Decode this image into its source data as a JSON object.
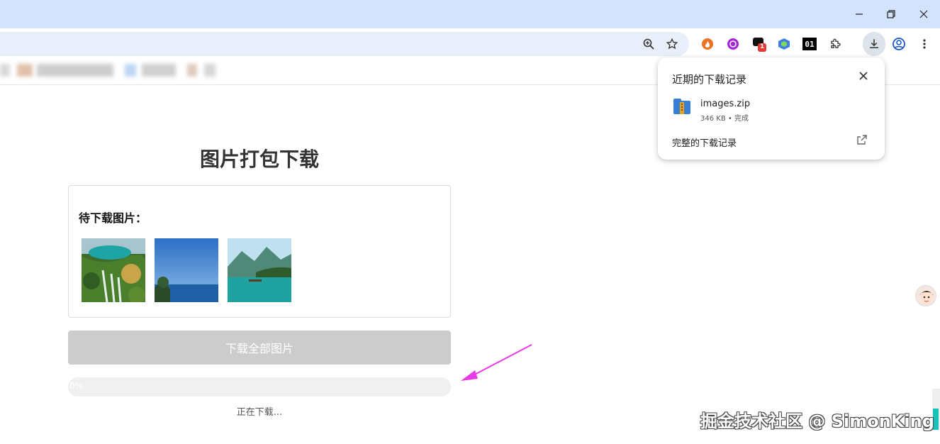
{
  "window": {
    "controls": [
      "minimize-icon",
      "restore-icon",
      "close-icon"
    ]
  },
  "toolbar": {
    "icons": [
      "zoom-icon",
      "star-icon",
      "extension-fire-icon",
      "extension-purple-icon",
      "extension-chat-icon",
      "extension-cube-icon",
      "extension-01-icon",
      "puzzle-icon",
      "download-icon",
      "profile-icon",
      "menu-icon"
    ],
    "chat_badge": "1",
    "ext01_label": "01"
  },
  "page": {
    "title": "图片打包下载",
    "card_label": "待下载图片：",
    "images": [
      "waterfall-image",
      "sea-sky-image",
      "lake-mountain-image"
    ],
    "download_button": "下载全部图片",
    "progress_text": "0%",
    "progress_value": 0,
    "status": "正在下载..."
  },
  "downloads_popup": {
    "title": "近期的下载记录",
    "file_name": "images.zip",
    "file_meta": "346 KB • 完成",
    "full_history": "完整的下载记录"
  },
  "watermark": "掘金技术社区 @ SimonKing",
  "colors": {
    "titlebar": "#d3e3fd",
    "omnibox": "#e9effa",
    "button_disabled": "#cccccc",
    "progress_track": "#f0f0f0",
    "annotation_arrow": "#e83ae6"
  }
}
